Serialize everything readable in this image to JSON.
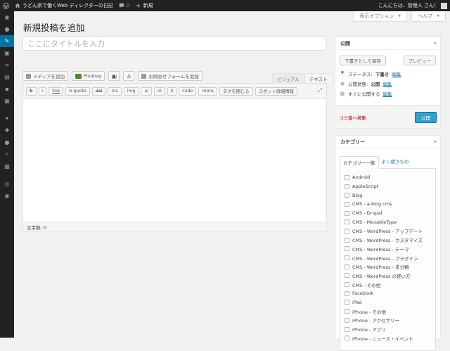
{
  "admin_bar": {
    "site_name": "うどん県で働くWeb ディレクターの日記",
    "comments_count": "0",
    "new_label": "新規",
    "greeting": "こんにちは、管理人 さん！"
  },
  "screen_meta": {
    "screen_options": "表示オプション",
    "help": "ヘルプ"
  },
  "page": {
    "title": "新規投稿を追加",
    "title_placeholder": "ここにタイトルを入力"
  },
  "media_buttons": {
    "add_media": "メディアを追加",
    "pixabay": "Pixabay",
    "contact_form": "お問合せフォームを追加"
  },
  "editor": {
    "tab_visual": "ビジュアル",
    "tab_text": "テキスト",
    "quicktags": [
      "b",
      "i",
      "link",
      "b-quote",
      "del",
      "ins",
      "img",
      "ul",
      "ol",
      "li",
      "code",
      "more",
      "タグを閉じる",
      "スポット詳細情報"
    ],
    "word_count": "文字数: 0"
  },
  "publish": {
    "heading": "公開",
    "save_draft": "下書きとして保存",
    "preview": "プレビュー",
    "status_label": "ステータス: ",
    "status_value": "下書き",
    "visibility_label": "公開状態: ",
    "visibility_value": "公開",
    "schedule_label": "すぐに公開する",
    "edit_link": "編集",
    "trash": "ゴミ箱へ移動",
    "publish_button": "公開"
  },
  "categories": {
    "heading": "カテゴリー",
    "tab_all": "カテゴリー一覧",
    "tab_popular": "よく使うもの",
    "items": [
      "Android",
      "AppleScript",
      "Blog",
      "CMS - a-blog cms",
      "CMS - Drupal",
      "CMS - MovableType",
      "CMS - WordPress - アップデート",
      "CMS - WordPress - カスタマイズ",
      "CMS - WordPress - テーマ",
      "CMS - WordPress - プラグイン",
      "CMS - WordPress - 未分類",
      "CMS - WordPress の使い方",
      "CMS - その他",
      "Facebook",
      "iPad",
      "iPhone - その他",
      "iPhone - アクセサリー",
      "iPhone - アプリ",
      "iPhone - ニュース・イベント"
    ]
  },
  "colors": {
    "admin_bar_bg": "#222222",
    "accent": "#0074a2",
    "primary_button": "#2ea2cc",
    "trash": "#aa0000"
  }
}
